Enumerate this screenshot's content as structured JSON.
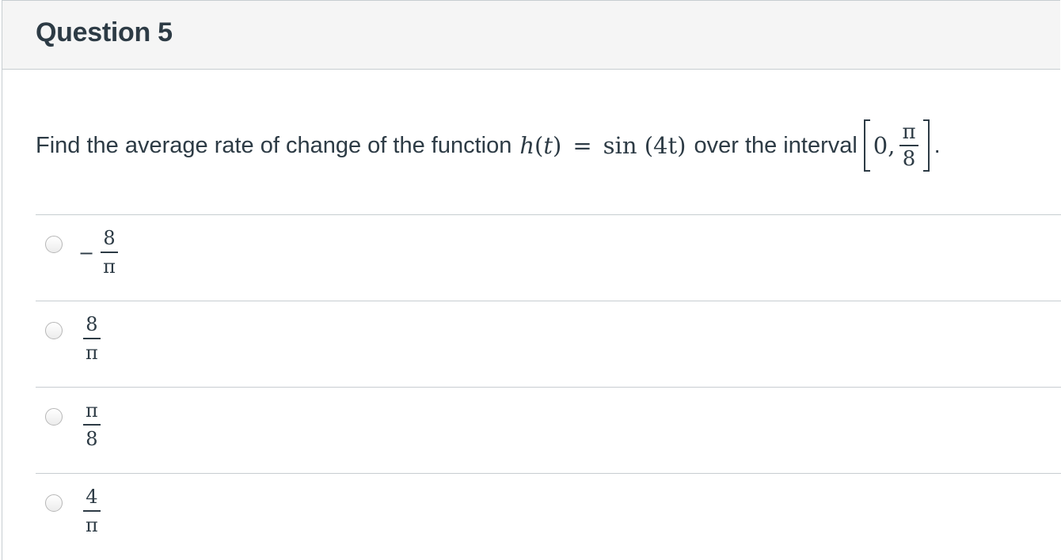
{
  "question": {
    "title": "Question 5",
    "prompt_text": "Find the average rate of change of the function",
    "function_name": "h",
    "function_var": "t",
    "equals": "=",
    "function_rhs_fn": "sin",
    "function_rhs_arg": "(4t)",
    "interval_text": "over the interval",
    "interval_left": "0,",
    "interval_right_num": "π",
    "interval_right_den": "8",
    "trailing": "."
  },
  "answers": [
    {
      "sign": "−",
      "numerator": "8",
      "denominator": "π"
    },
    {
      "sign": "",
      "numerator": "8",
      "denominator": "π"
    },
    {
      "sign": "",
      "numerator": "π",
      "denominator": "8"
    },
    {
      "sign": "",
      "numerator": "4",
      "denominator": "π"
    }
  ]
}
